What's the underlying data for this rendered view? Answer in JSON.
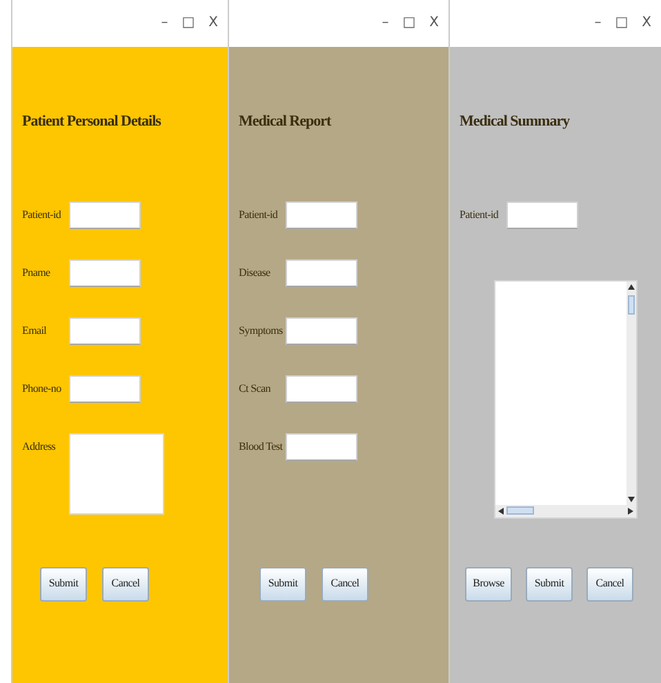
{
  "windows": [
    {
      "controls": [
        "–",
        "□",
        "X"
      ],
      "color": "#fdc600",
      "heading": "Patient Personal Details",
      "fields": [
        {
          "kind": "text",
          "label": "Patient-id"
        },
        {
          "kind": "text",
          "label": "Pname"
        },
        {
          "kind": "text",
          "label": "Email"
        },
        {
          "kind": "text",
          "label": "Phone-no"
        },
        {
          "kind": "textarea",
          "label": "Address"
        }
      ],
      "buttons": [
        "Submit",
        "Cancel"
      ]
    },
    {
      "controls": [
        "–",
        "□",
        "X"
      ],
      "color": "#b5a886",
      "heading": "Medical Report",
      "fields": [
        {
          "kind": "text",
          "label": "Patient-id"
        },
        {
          "kind": "text",
          "label": "Disease"
        },
        {
          "kind": "text",
          "label": "Symptoms"
        },
        {
          "kind": "text",
          "label": "Ct Scan"
        },
        {
          "kind": "text",
          "label": "Blood Test"
        }
      ],
      "buttons": [
        "Submit",
        "Cancel"
      ]
    },
    {
      "controls": [
        "–",
        "□",
        "X"
      ],
      "color": "#c0c0c0",
      "heading": "Medical Summary",
      "fields": [
        {
          "kind": "text",
          "label": "Patient-id"
        },
        {
          "kind": "scroll_area"
        }
      ],
      "buttons": [
        "Browse",
        "Submit",
        "Cancel"
      ]
    }
  ]
}
